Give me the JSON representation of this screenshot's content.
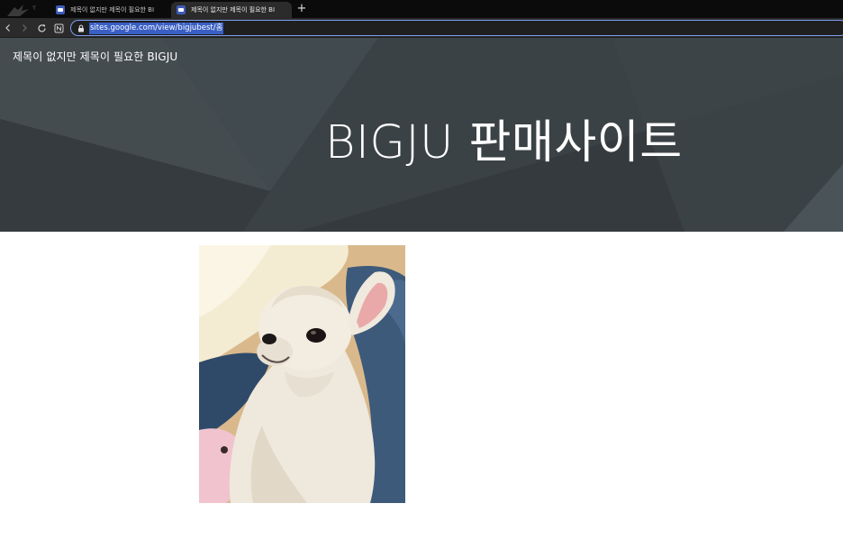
{
  "browser": {
    "tabs": [
      {
        "title": "제목이 없지만 제목이 필요한 BI",
        "active": false,
        "favicon": "google-sites-icon"
      },
      {
        "title": "제목이 없지만 제목이 필요한 BI",
        "active": true,
        "favicon": "google-sites-icon"
      }
    ],
    "new_tab_label": "+",
    "address_url": "sites.google.com/view/bigjubest/홈",
    "icons": [
      "back-icon",
      "forward-icon",
      "reload-icon",
      "extension-icon",
      "lock-icon"
    ],
    "colors": {
      "tabstrip": "#0b0b0b",
      "toolbar": "#2b2b2b",
      "url_highlight": "#3a5fc4"
    }
  },
  "site": {
    "name": "제목이 없지만 제목이 필요한 BIGJU",
    "hero_title": "BIGJU 판매사이트",
    "hero_color": "#3b4246"
  },
  "content": {
    "image": "dog-photo"
  }
}
